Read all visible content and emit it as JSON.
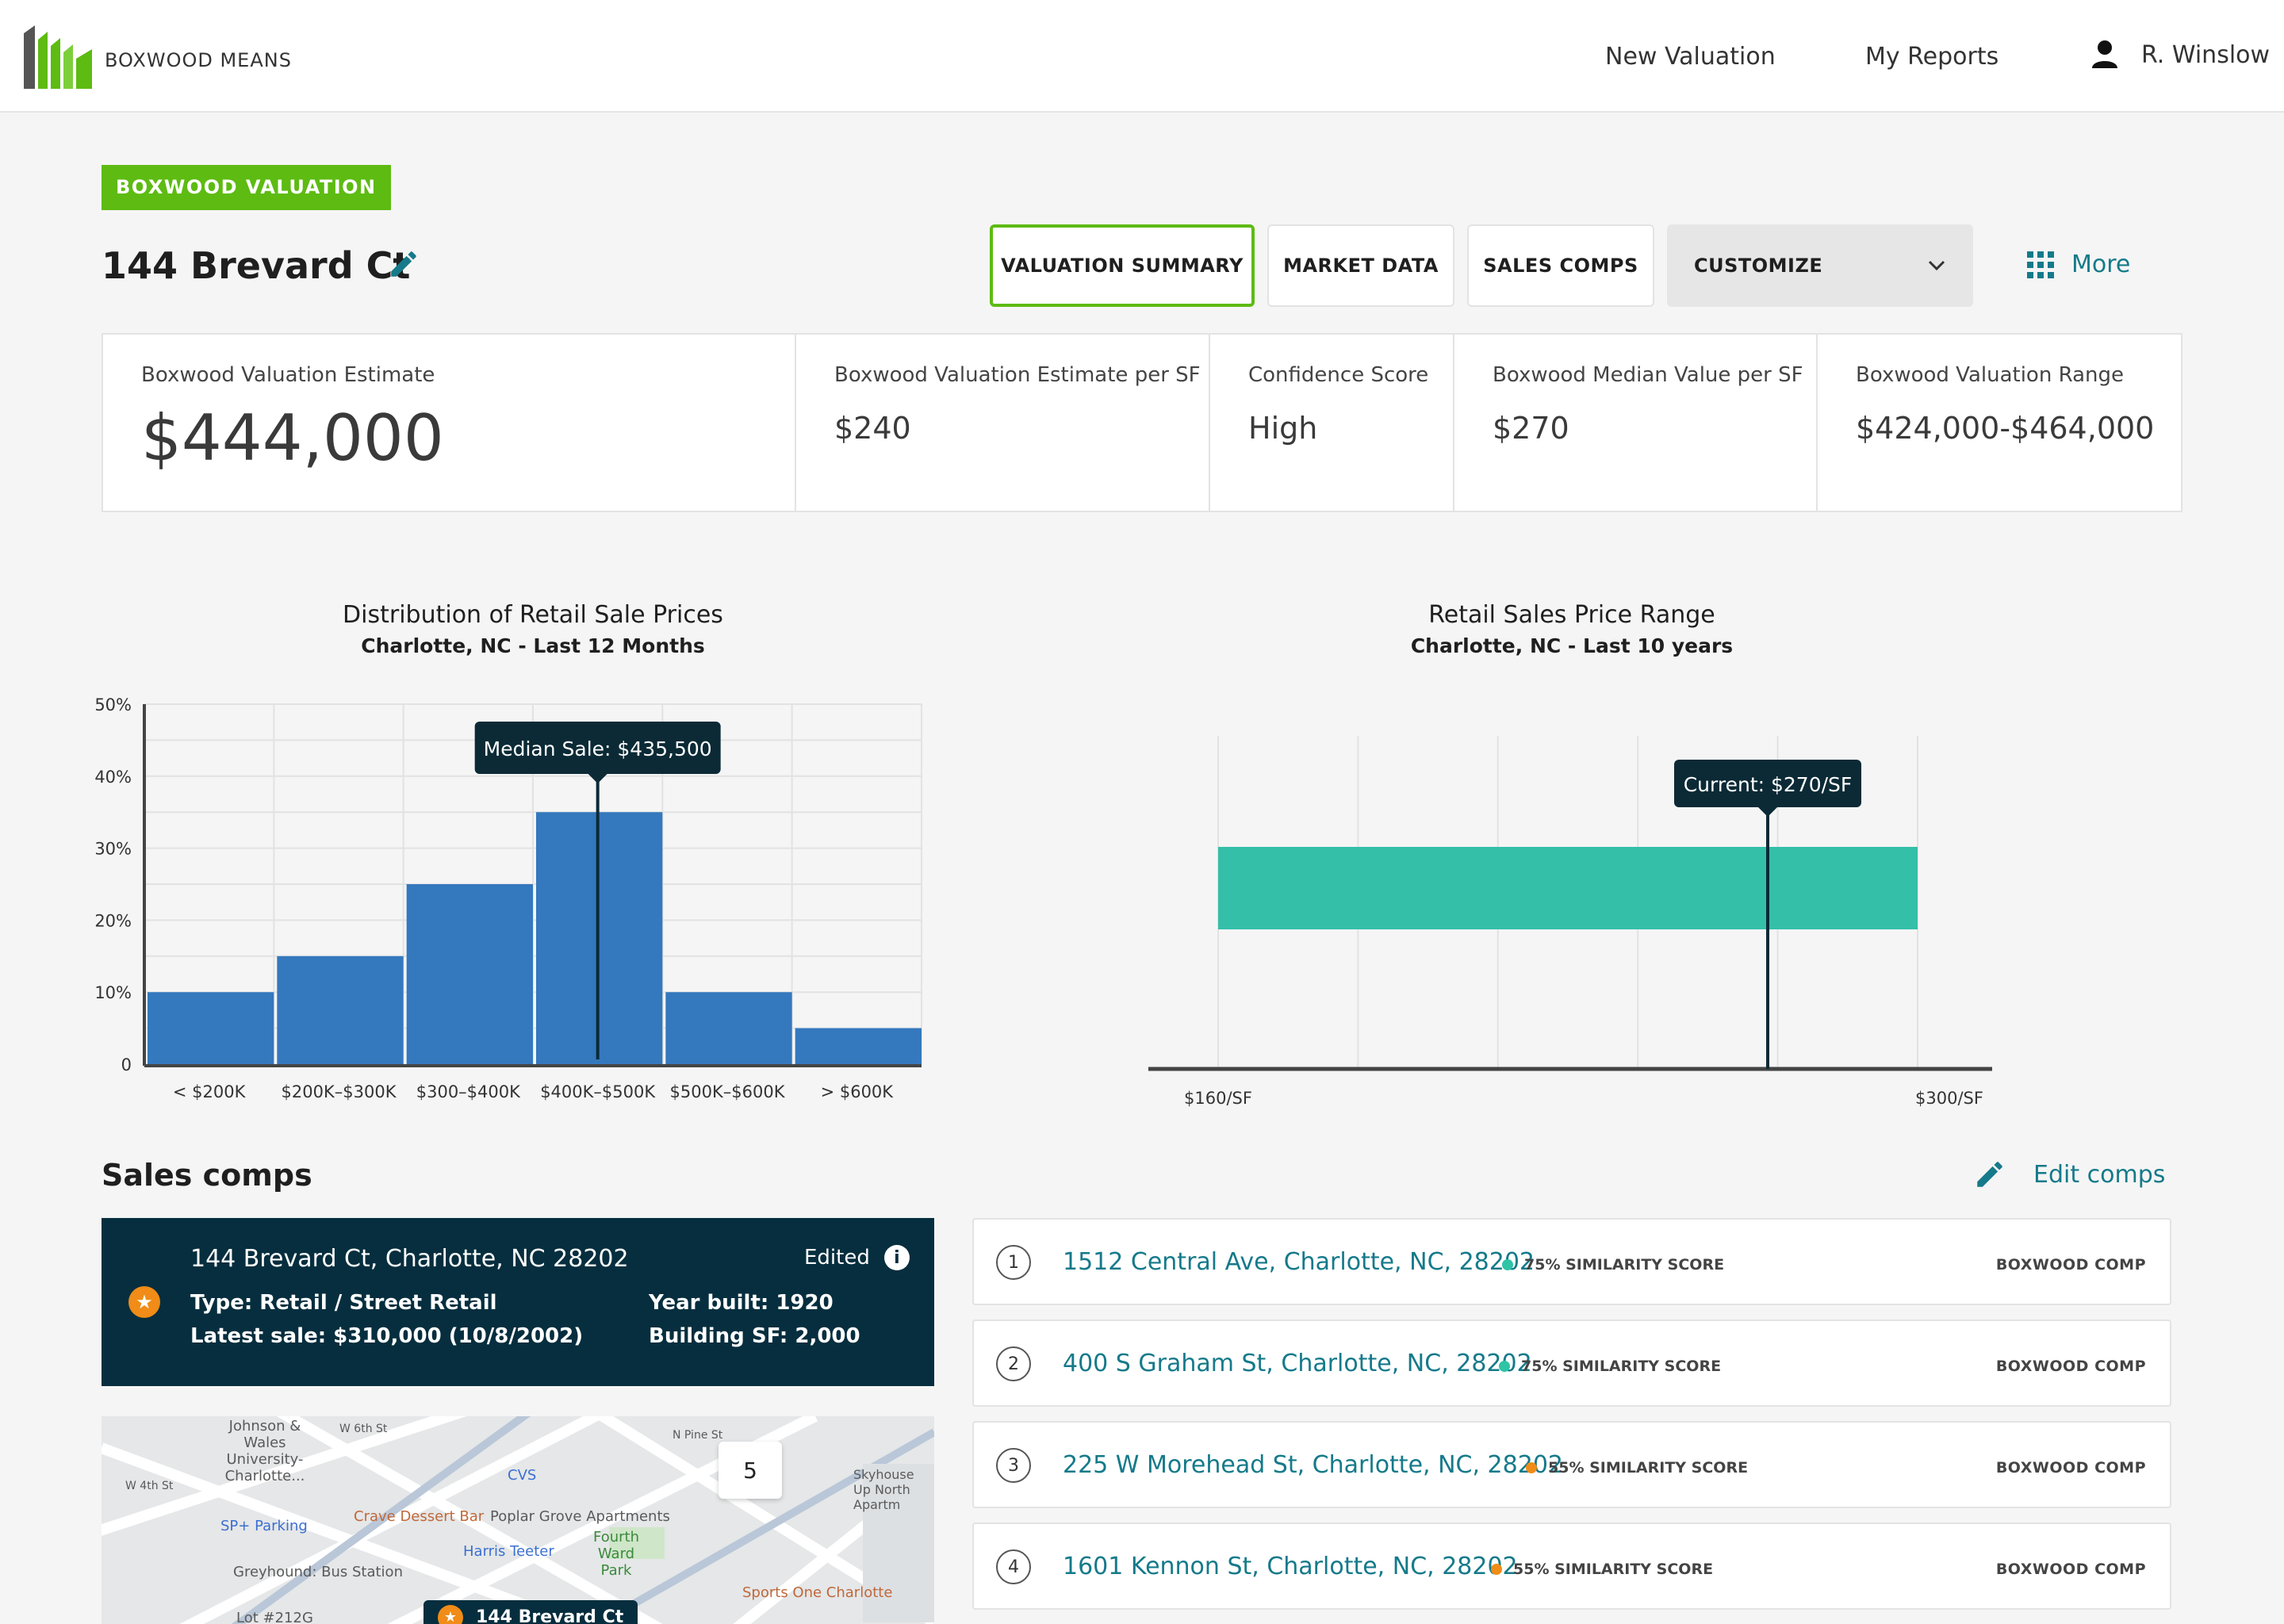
{
  "header": {
    "brand": "BOXWOOD MEANS",
    "nav": [
      "New Valuation",
      "My Reports"
    ],
    "user": "R. Winslow"
  },
  "title": {
    "badge": "BOXWOOD VALUATION",
    "address": "144 Brevard Ct"
  },
  "tabs": {
    "valuation_summary": "VALUATION SUMMARY",
    "market_data": "MARKET DATA",
    "sales_comps": "SALES COMPS",
    "customize": "CUSTOMIZE",
    "more": "More"
  },
  "kpis": [
    {
      "label": "Boxwood Valuation Estimate",
      "value": "$444,000"
    },
    {
      "label": "Boxwood Valuation Estimate per SF",
      "value": "$240"
    },
    {
      "label": "Confidence Score",
      "value": "High"
    },
    {
      "label": "Boxwood Median Value per SF",
      "value": "$270"
    },
    {
      "label": "Boxwood Valuation Range",
      "value": "$424,000-$464,000"
    }
  ],
  "chart_data": [
    {
      "type": "bar",
      "title": "Distribution of Retail Sale Prices",
      "subtitle": "Charlotte, NC - Last 12 Months",
      "categories": [
        "< $200K",
        "$200K–$300K",
        "$300–$400K",
        "$400K–$500K",
        "$500K–$600K",
        "> $600K"
      ],
      "values": [
        10,
        15,
        25,
        35,
        10,
        5
      ],
      "yticks": [
        "0",
        "10%",
        "20%",
        "30%",
        "40%",
        "50%"
      ],
      "ylim": [
        0,
        50
      ],
      "grid": true,
      "annotation": {
        "label": "Median Sale: $435,500",
        "category_index": 3,
        "fraction": 0.5
      }
    },
    {
      "type": "bar",
      "title": "Retail Sales Price Range",
      "subtitle": "Charlotte, NC - Last 10 years",
      "xlim": [
        160,
        300
      ],
      "range": [
        160,
        300
      ],
      "current": 270,
      "current_label": "Current: $270/SF",
      "xticks": [
        "$160/SF",
        "$300/SF"
      ],
      "grid": true
    }
  ],
  "sales_comps": {
    "heading": "Sales comps",
    "edit_label": "Edit comps",
    "subject": {
      "address": "144 Brevard Ct, Charlotte, NC 28202",
      "edited": "Edited",
      "type": "Type: Retail / Street Retail",
      "latest_sale": "Latest sale: $310,000 (10/8/2002)",
      "year_built": "Year built: 1920",
      "building_sf": "Building SF: 2,000"
    },
    "comps": [
      {
        "num": "1",
        "address": "1512 Central Ave, Charlotte, NC, 28202",
        "score": "75% SIMILARITY SCORE",
        "score_color": "#2fc4a5",
        "tag": "BOXWOOD COMP"
      },
      {
        "num": "2",
        "address": "400 S Graham St, Charlotte, NC, 28202",
        "score": "75% SIMILARITY SCORE",
        "score_color": "#2fc4a5",
        "tag": "BOXWOOD COMP"
      },
      {
        "num": "3",
        "address": "225 W Morehead St, Charlotte, NC, 28202",
        "score": "55% SIMILARITY SCORE",
        "score_color": "#f08c17",
        "tag": "BOXWOOD COMP"
      },
      {
        "num": "4",
        "address": "1601 Kennon St, Charlotte, NC, 28202",
        "score": "55% SIMILARITY SCORE",
        "score_color": "#f08c17",
        "tag": "BOXWOOD COMP"
      }
    ]
  },
  "map": {
    "labels": [
      "Johnson & Wales University-Charlotte...",
      "W 6th St",
      "N Pine St",
      "CVS",
      "Skyhouse Up North Apartm",
      "Crave Dessert Bar",
      "Poplar Grove Apartments",
      "W 4th St",
      "SP+ Parking",
      "Harris Teeter",
      "Fourth Ward Park",
      "Greyhound: Bus Station",
      "Sports One Charlotte",
      "Lot #212G",
      "144 Brevard Ct"
    ],
    "cluster": "5"
  },
  "colors": {
    "accent_green": "#5dbb12",
    "teal_link": "#157a8a",
    "navy": "#062e3e",
    "bar_blue": "#3478be",
    "range_teal": "#34bfa9"
  }
}
